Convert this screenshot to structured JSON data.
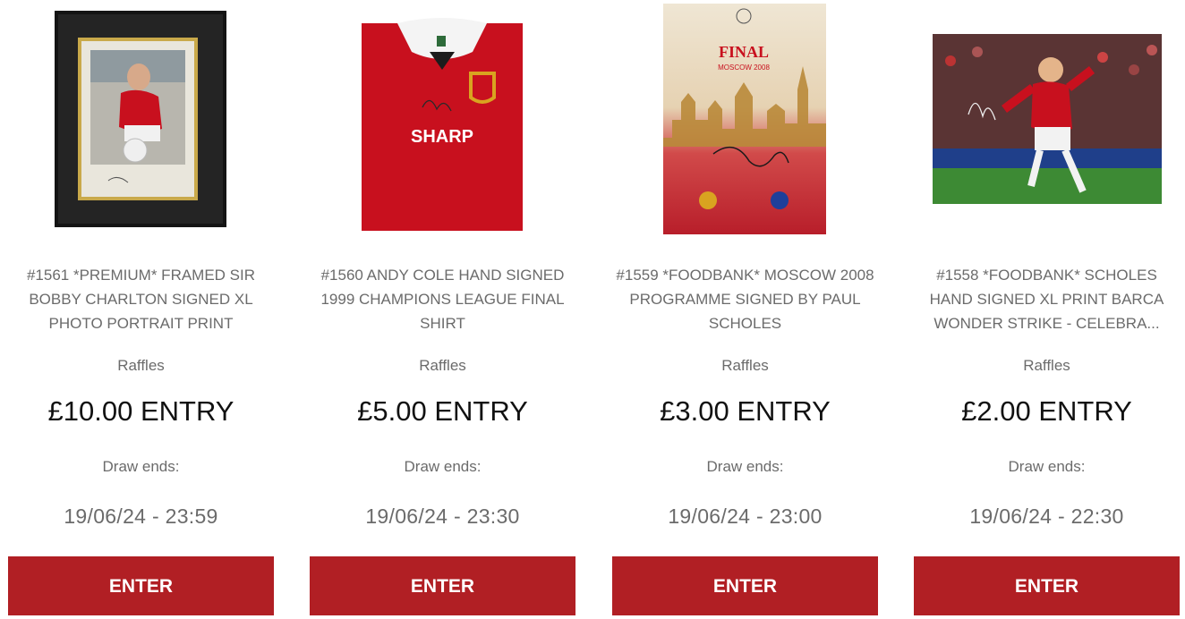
{
  "products": [
    {
      "title": "#1561 *PREMIUM* FRAMED SIR BOBBY CHARLTON SIGNED XL PHOTO PORTRAIT PRINT",
      "category": "Raffles",
      "price": "£10.00 ENTRY",
      "draw_label": "Draw ends:",
      "draw_date": "19/06/24 - 23:59",
      "button_label": "ENTER",
      "image_icon": "framed-photo"
    },
    {
      "title": "#1560 ANDY COLE HAND SIGNED 1999 CHAMPIONS LEAGUE FINAL SHIRT",
      "category": "Raffles",
      "price": "£5.00 ENTRY",
      "draw_label": "Draw ends:",
      "draw_date": "19/06/24 - 23:30",
      "button_label": "ENTER",
      "image_icon": "football-shirt",
      "image_text": "SHARP"
    },
    {
      "title": "#1559 *FOODBANK* MOSCOW 2008 PROGRAMME SIGNED BY PAUL SCHOLES",
      "category": "Raffles",
      "price": "£3.00 ENTRY",
      "draw_label": "Draw ends:",
      "draw_date": "19/06/24 - 23:00",
      "button_label": "ENTER",
      "image_icon": "match-programme",
      "image_text": "FINAL",
      "image_subtext": "MOSCOW 2008"
    },
    {
      "title": "#1558 *FOODBANK* SCHOLES HAND SIGNED XL PRINT BARCA WONDER STRIKE - CELEBRA...",
      "category": "Raffles",
      "price": "£2.00 ENTRY",
      "draw_label": "Draw ends:",
      "draw_date": "19/06/24 - 22:30",
      "button_label": "ENTER",
      "image_icon": "celebration-photo"
    }
  ],
  "colors": {
    "button_bg": "#b11f24",
    "button_text": "#ffffff",
    "muted_text": "#6b6b6b",
    "price_text": "#111111",
    "shirt_red": "#c8101e"
  }
}
